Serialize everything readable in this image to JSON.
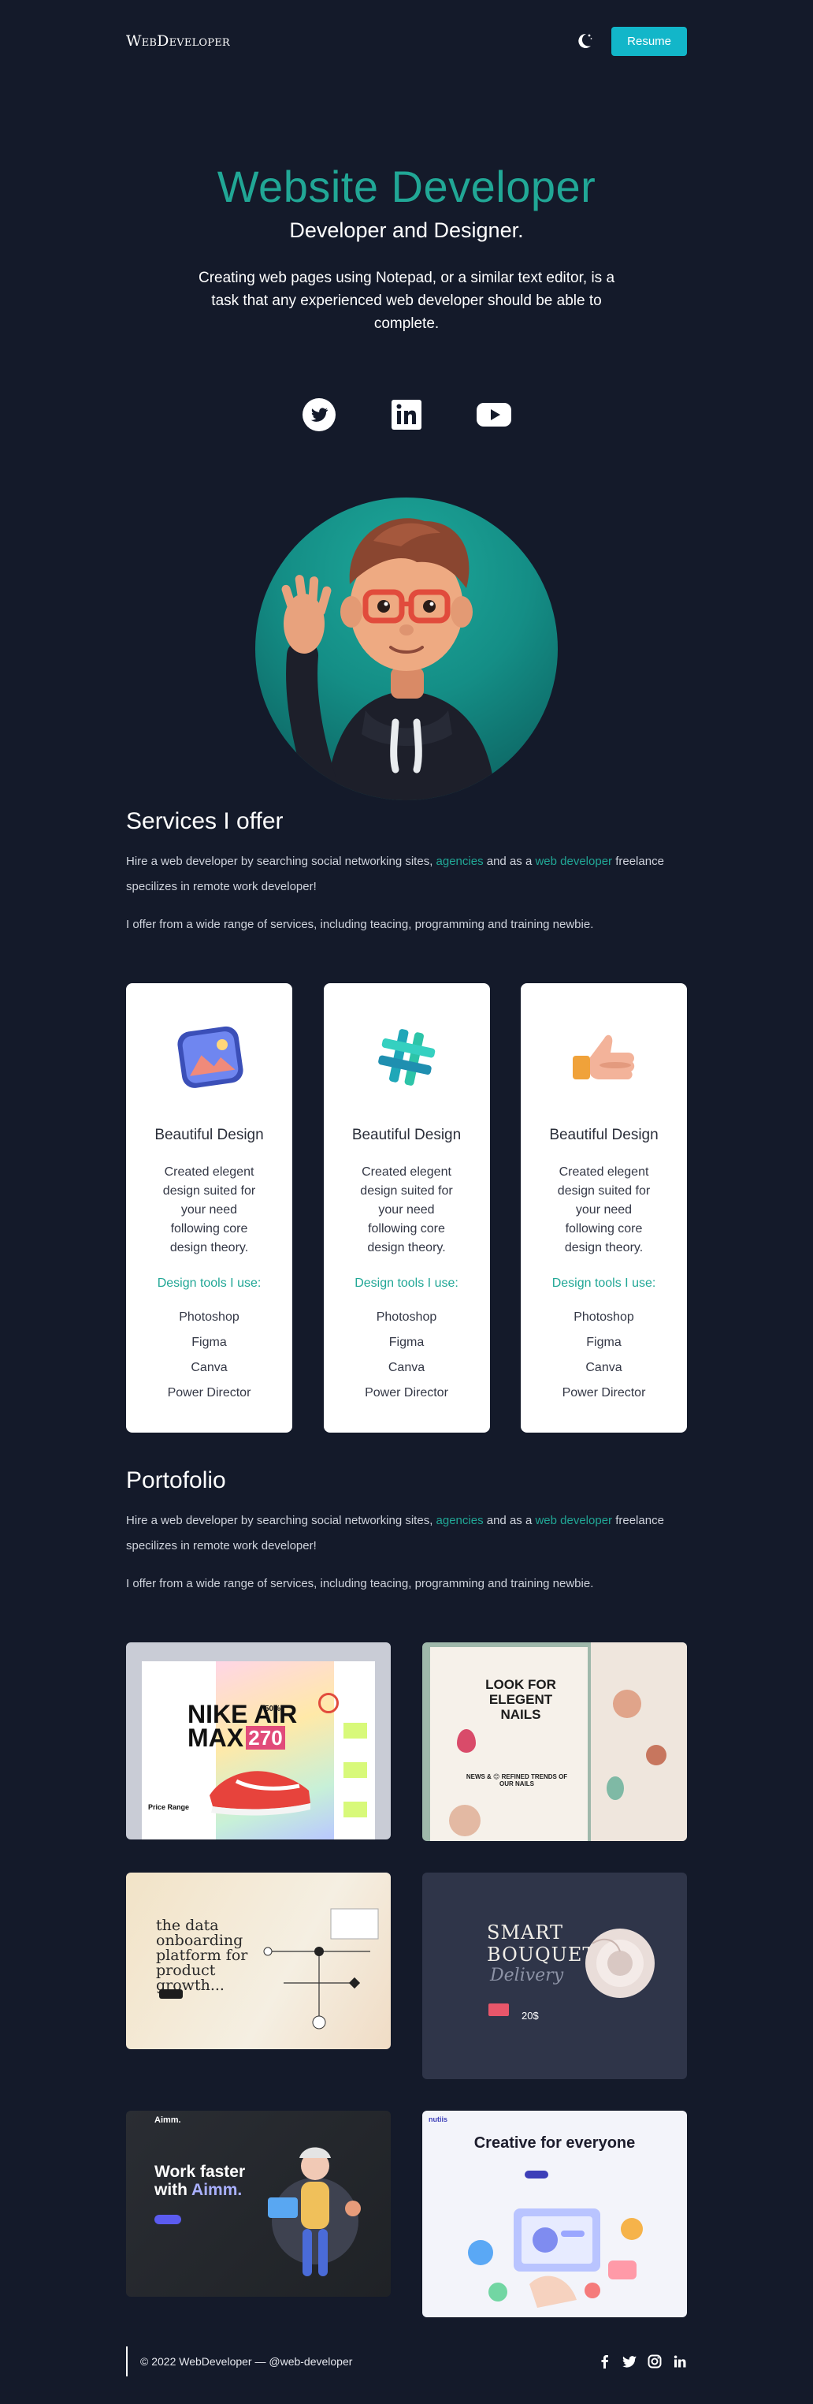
{
  "nav": {
    "logo": "WebDeveloper",
    "theme_icon": "moon-icon",
    "resume_label": "Resume"
  },
  "hero": {
    "title": "Website Developer",
    "subtitle": "Developer and Designer.",
    "description": "Creating web pages using Notepad, or a similar text editor, is a task that any experienced web developer should be able to complete.",
    "socials": [
      {
        "name": "twitter-icon"
      },
      {
        "name": "linkedin-icon"
      },
      {
        "name": "youtube-icon"
      }
    ]
  },
  "services": {
    "title": "Services I offer",
    "para1_pre": "Hire a web developer by searching social networking sites, ",
    "para1_link1": "agencies",
    "para1_mid": " and as a ",
    "para1_link2": "web developer",
    "para1_post": " freelance specilizes in remote work developer!",
    "para2": "I offer from a wide range of services, including teacing, programming and training newbie.",
    "cards": [
      {
        "icon": "picture-icon",
        "title": "Beautiful Design",
        "desc": "Created elegent design suited for your need following core design theory.",
        "tools_heading": "Design tools I use:",
        "tools": [
          "Photoshop",
          "Figma",
          "Canva",
          "Power Director"
        ]
      },
      {
        "icon": "hashtag-icon",
        "title": "Beautiful Design",
        "desc": "Created elegent design suited for your need following core design theory.",
        "tools_heading": "Design tools I use:",
        "tools": [
          "Photoshop",
          "Figma",
          "Canva",
          "Power Director"
        ]
      },
      {
        "icon": "thumbs-up-icon",
        "title": "Beautiful Design",
        "desc": "Created elegent design suited for your need following core design theory.",
        "tools_heading": "Design tools I use:",
        "tools": [
          "Photoshop",
          "Figma",
          "Canva",
          "Power Director"
        ]
      }
    ]
  },
  "portfolio": {
    "title": "Portofolio",
    "para1_pre": "Hire a web developer by searching social networking sites, ",
    "para1_link1": "agencies",
    "para1_mid": " and as a ",
    "para1_link2": "web developer",
    "para1_post": " freelance specilizes in remote work developer!",
    "para2": "I offer from a wide range of services, including teacing, programming and training newbie.",
    "shots": {
      "nike": {
        "headline1": "NIKE AIR",
        "headline2": "MAX",
        "num": "270",
        "pct": "50%",
        "price_label": "Price Range"
      },
      "nails": {
        "headline": "LOOK FOR ELEGENT NAILS",
        "news": "NEWS & 😊 REFINED TRENDS OF OUR NAILS"
      },
      "onboard": {
        "headline": "the data onboarding platform for product growth..."
      },
      "bouquet": {
        "headline1": "SMART",
        "headline2": "BOUQUET",
        "script": "Delivery",
        "price": "20$"
      },
      "aimm": {
        "brand": "Aimm.",
        "headline1": "Work faster",
        "headline2": "with ",
        "accent": "Aimm."
      },
      "creative": {
        "brand": "nutiis",
        "headline": "Creative for everyone"
      }
    }
  },
  "footer": {
    "copyright": "© 2022 WebDeveloper — @web-developer",
    "icons": [
      "facebook-icon",
      "twitter-icon",
      "instagram-icon",
      "linkedin-icon"
    ]
  }
}
